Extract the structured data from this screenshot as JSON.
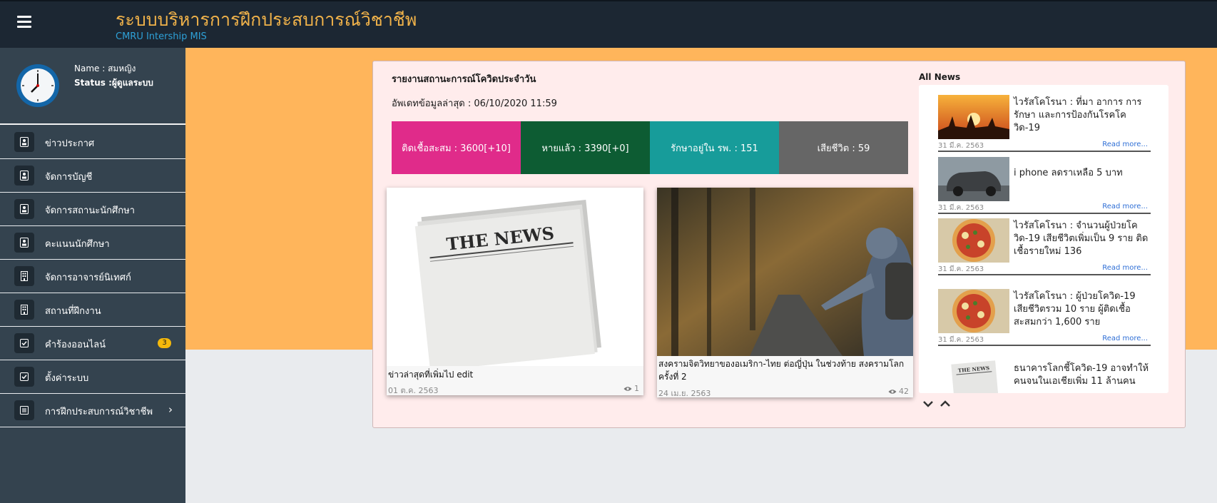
{
  "header": {
    "title": "ระบบบริหารการฝึกประสบการณ์วิชาชีพ",
    "subtitle": "CMRU Intership MIS"
  },
  "profile": {
    "name_line": "Name : สมหญิง",
    "status_line": "Status :ผู้ดูแลระบบ"
  },
  "sidebar": {
    "items": [
      {
        "label": "ข่าวประกาศ",
        "icon": "badge-icon"
      },
      {
        "label": "จัดการบัญชี",
        "icon": "badge-icon"
      },
      {
        "label": "จัดการสถานะนักศึกษา",
        "icon": "badge-icon"
      },
      {
        "label": "คะแนนนักศึกษา",
        "icon": "badge-icon"
      },
      {
        "label": "จัดการอาจารย์นิเทศก์",
        "icon": "building-icon"
      },
      {
        "label": "สถานที่ฝึกงาน",
        "icon": "building-icon"
      },
      {
        "label": "คำร้องออนไลน์",
        "icon": "check-square-icon",
        "badge": "3"
      },
      {
        "label": "ตั้งค่าระบบ",
        "icon": "check-square-icon"
      },
      {
        "label": "การฝึกประสบการณ์วิชาชีพ",
        "icon": "list-icon",
        "chevron": "›"
      }
    ]
  },
  "covid": {
    "title": "รายงานสถานะการณ์โควิดประจำวัน",
    "updated": "อัพเดทข้อมูลล่าสุด : 06/10/2020 11:59",
    "stats": [
      {
        "label": "ติดเชื้อสะสม : 3600[+10]",
        "color": "#e02b8a"
      },
      {
        "label": "หายแล้ว : 3390[+0]",
        "color": "#0d5c33"
      },
      {
        "label": "รักษาอยู่ใน รพ. : 151",
        "color": "#179c9a"
      },
      {
        "label": "เสียชีวิต : 59",
        "color": "#666666"
      }
    ]
  },
  "news_cards": [
    {
      "caption": "ข่าวล่าสุดที่เพิ่มไป edit",
      "date": "01 ต.ค. 2563",
      "views": "1",
      "image_text": "THE NEWS"
    },
    {
      "caption": "สงครามจิตวิทยาของอเมริกา-ไทย ต่อญี่ปุ่น ในช่วงท้าย สงครามโลกครั้งที่ 2",
      "date": "24 เม.ย. 2563",
      "views": "42"
    }
  ],
  "all_news": {
    "title": "All News",
    "read_more": "Read more...",
    "items": [
      {
        "title": "ไวรัสโคโรนา : ที่มา อาการ การรักษา และการป้องกันโรคโควิด-19",
        "date": "31 มี.ค. 2563"
      },
      {
        "title": "i phone ลดราเหลือ 5 บาท",
        "date": "31 มี.ค. 2563"
      },
      {
        "title": "ไวรัสโคโรนา : จำนวนผู้ป่วยโควิด-19 เสียชีวิตเพิ่มเป็น 9 ราย ติดเชื้อรายใหม่ 136",
        "date": "31 มี.ค. 2563"
      },
      {
        "title": "ไวรัสโคโรนา : ผู้ป่วยโควิด-19 เสียชีวิตรวม 10 ราย ผู้ติดเชื้อสะสมกว่า 1,600 ราย",
        "date": "31 มี.ค. 2563"
      },
      {
        "title": "ธนาคารโลกชี้โควิด-19 อาจทำให้คนจนในเอเชียเพิ่ม 11 ล้านคน",
        "thumb_text": "THE NEWS"
      }
    ]
  },
  "icons": {
    "menu": "hamburger-icon",
    "clock": "clock-icon",
    "views": "eye-icon",
    "scroll_down": "chevron-down-icon",
    "scroll_up": "chevron-up-icon"
  }
}
